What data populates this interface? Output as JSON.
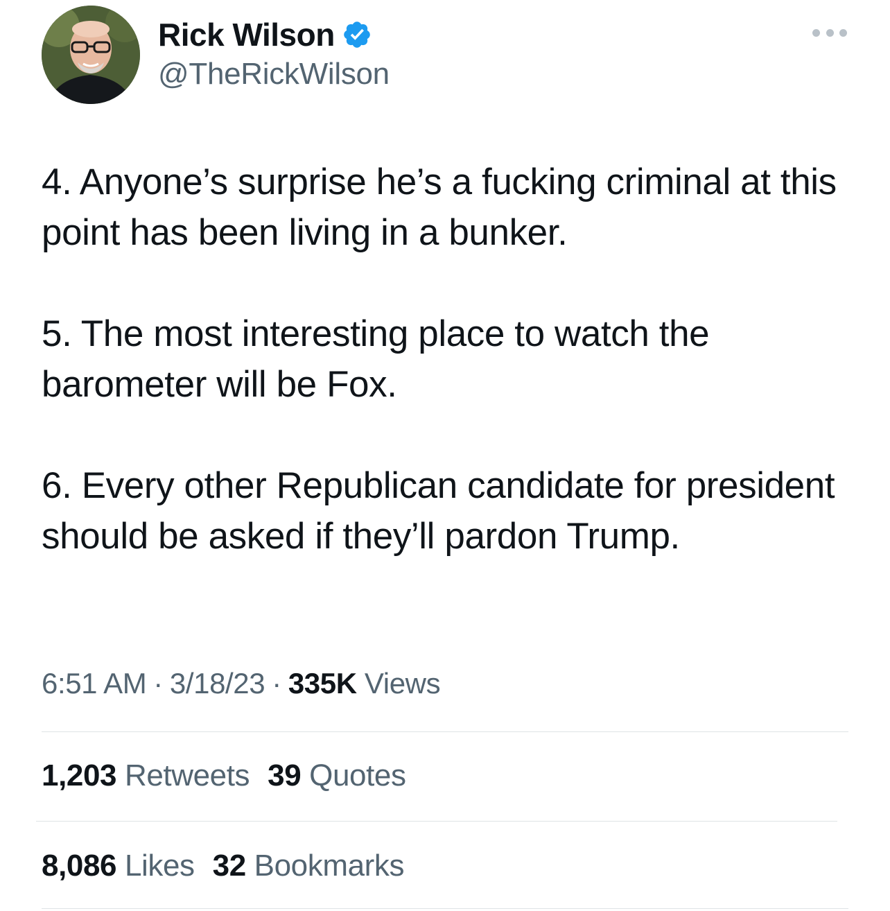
{
  "author": {
    "display_name": "Rick Wilson",
    "handle": "@TheRickWilson",
    "verified_icon": "verified-badge-icon",
    "verified_color": "#1d9bf0"
  },
  "tweet": {
    "paragraphs": [
      "4. Anyone’s surprise he’s a fucking criminal at this point has been living in a bunker.",
      "5. The most interesting place to watch the barometer will be Fox.",
      "6. Every other Republican candidate for president should be asked if they’ll pardon Trump."
    ]
  },
  "meta": {
    "time": "6:51 AM",
    "date": "3/18/23",
    "separator": "·",
    "views_count": "335K",
    "views_label": "Views"
  },
  "stats": {
    "retweets_count": "1,203",
    "retweets_label": "Retweets",
    "quotes_count": "39",
    "quotes_label": "Quotes",
    "likes_count": "8,086",
    "likes_label": "Likes",
    "bookmarks_count": "32",
    "bookmarks_label": "Bookmarks"
  },
  "colors": {
    "text_primary": "#0f1419",
    "text_secondary": "#536471",
    "divider": "#dfe3e6"
  }
}
